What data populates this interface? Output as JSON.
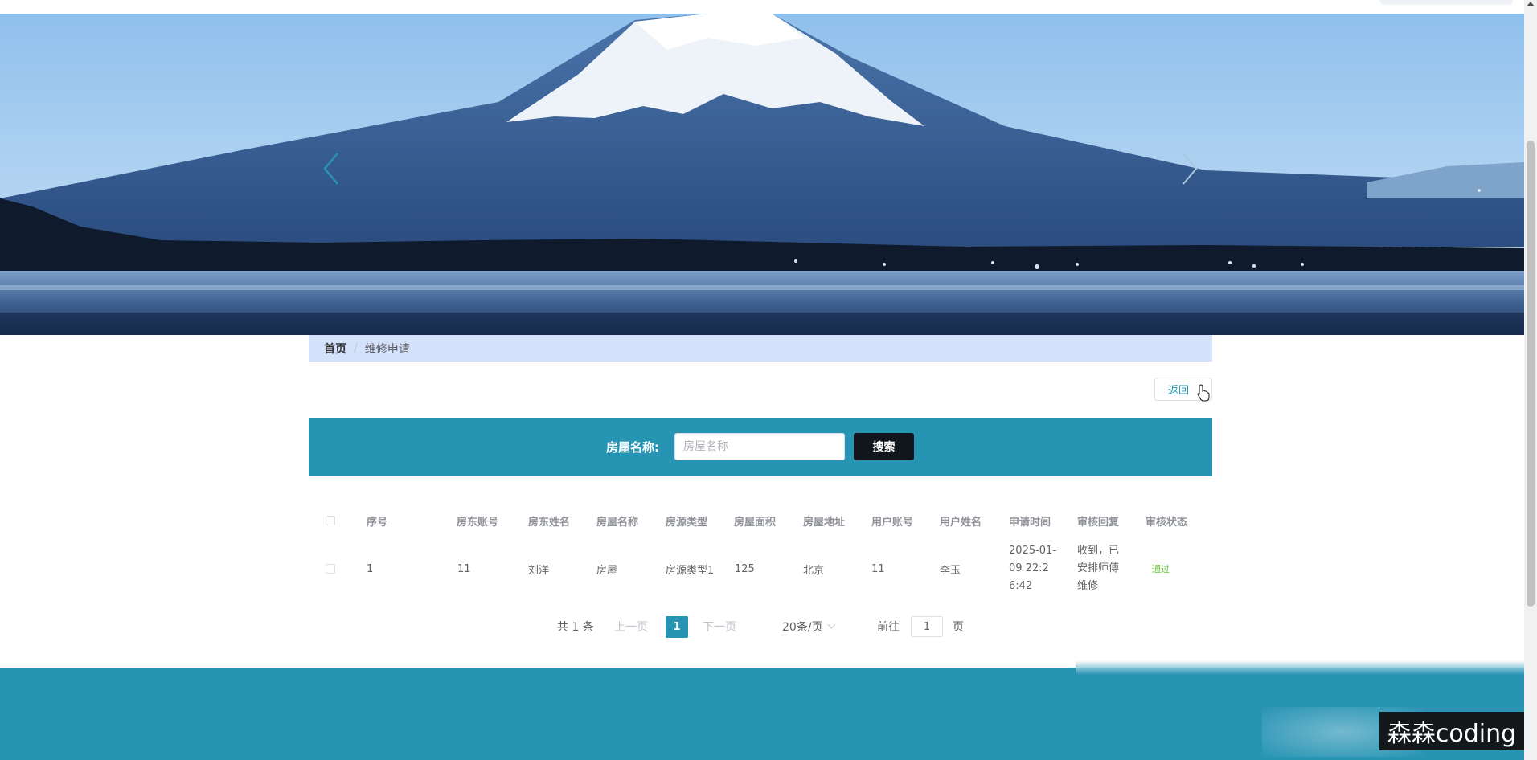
{
  "breadcrumb": {
    "home": "首页",
    "separator": "/",
    "current": "维修申请"
  },
  "back_button": {
    "label": "返回"
  },
  "search": {
    "label": "房屋名称:",
    "placeholder": "房屋名称",
    "value": "",
    "button_label": "搜索"
  },
  "table": {
    "headers": [
      "序号",
      "房东账号",
      "房东姓名",
      "房屋名称",
      "房源类型",
      "房屋面积",
      "房屋地址",
      "用户账号",
      "用户姓名",
      "申请时间",
      "审核回复",
      "审核状态"
    ],
    "rows": [
      {
        "index": "1",
        "landlord_account": "11",
        "landlord_name": "刘洋",
        "house_name": "房屋",
        "house_type": "房源类型1",
        "area": "125",
        "address": "北京",
        "user_account": "11",
        "user_name": "李玉",
        "apply_time": "2025-01-09 22:26:42",
        "reply": "收到，已安排师傅维修",
        "status": "通过"
      }
    ]
  },
  "pagination": {
    "total": "共 1 条",
    "prev": "上一页",
    "current_page": "1",
    "next": "下一页",
    "page_size": "20条/页",
    "goto_label": "前往",
    "goto_value": "1",
    "goto_suffix": "页"
  },
  "watermark": "森森coding",
  "colors": {
    "accent": "#2894b4",
    "breadcrumb_bg": "#d4e1fb",
    "search_button": "#10161b",
    "status_pass": "#67c23a"
  }
}
